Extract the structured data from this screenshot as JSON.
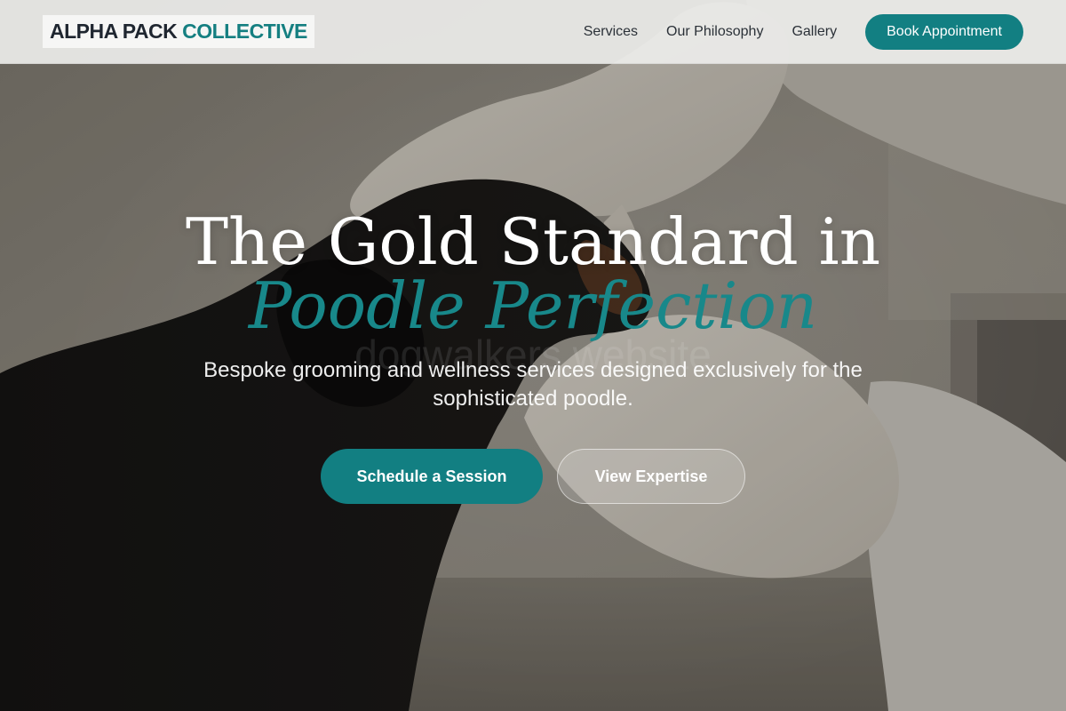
{
  "brand": {
    "name_part1": "ALPHA PACK",
    "name_part2": "COLLECTIVE"
  },
  "nav": {
    "links": [
      "Services",
      "Our Philosophy",
      "Gallery"
    ],
    "cta_label": "Book Appointment"
  },
  "hero": {
    "headline_line1": "The Gold Standard in",
    "headline_line2": "Poodle Perfection",
    "watermark": "dogwalkers website",
    "subheadline": "Bespoke grooming and wellness services designed exclusively for the sophisticated poodle.",
    "primary_cta": "Schedule a Session",
    "secondary_cta": "View Expertise",
    "background_image": "dog-grooming-photo"
  },
  "colors": {
    "accent": "#127f82",
    "accent_text": "#157f81",
    "header_bg": "#ececea",
    "text_dark": "#1f2630"
  }
}
